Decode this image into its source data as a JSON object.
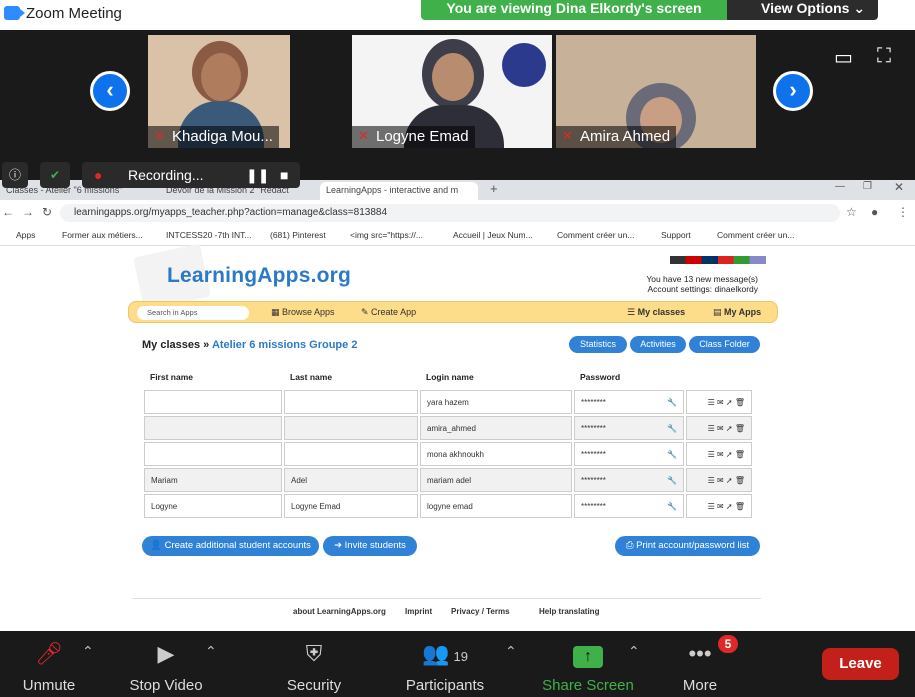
{
  "zoom": {
    "title": "Zoom Meeting",
    "viewing_banner": "You are viewing Dina Elkordy's screen",
    "view_options": "View Options"
  },
  "participants": [
    {
      "name": "Khadiga Mou...",
      "bg": "#d9c2a8"
    },
    {
      "name": "Logyne Emad",
      "bg": "#f4f4f4"
    },
    {
      "name": "Amira Ahmed",
      "bg": "#c7b299"
    }
  ],
  "recording": {
    "label": "Recording..."
  },
  "tabs": [
    "Classes - Atelier \"6 missions\"",
    "Devoir de la Mission 2 \"Rédact",
    "LearningApps - interactive and m"
  ],
  "address": {
    "url": "learningapps.org/myapps_teacher.php?action=manage&class=813884"
  },
  "bookmarks": [
    "Apps",
    "Former aux métiers...",
    "INTCESS20 -7th INT...",
    "(681) Pinterest",
    "<img src=\"https://...",
    "Accueil | Jeux Num...",
    "Comment créer un...",
    "Support",
    "Comment créer un..."
  ],
  "site": {
    "logo": "LearningApps.org",
    "messages": "You have 13 new message(s)",
    "account": "Account settings: dinaelkordy",
    "search_placeholder": "Search in Apps",
    "browse": "Browse Apps",
    "create": "Create App",
    "my_classes": "My classes",
    "my_apps": "My Apps"
  },
  "crumb": {
    "root": "My classes",
    "sep": "»",
    "class_name": "Atelier 6 missions Groupe 2"
  },
  "actions": {
    "statistics": "Statistics",
    "activities": "Activities",
    "folder": "Class Folder"
  },
  "table": {
    "headers": [
      "First name",
      "Last name",
      "Login name",
      "Password"
    ],
    "rows": [
      {
        "first": "",
        "last": "",
        "login": "yara hazem",
        "pw": "********"
      },
      {
        "first": "",
        "last": "",
        "login": "amira_ahmed",
        "pw": "********"
      },
      {
        "first": "",
        "last": "",
        "login": "mona akhnoukh",
        "pw": "********"
      },
      {
        "first": "Mariam",
        "last": "Adel",
        "login": "mariam adel",
        "pw": "********"
      },
      {
        "first": "Logyne",
        "last": "Logyne Emad",
        "login": "logyne emad",
        "pw": "********"
      }
    ]
  },
  "buttons": {
    "create_accounts": "Create additional student accounts",
    "invite": "Invite students",
    "print": "Print account/password list"
  },
  "footer": {
    "about": "about LearningApps.org",
    "imprint": "Imprint",
    "privacy": "Privacy / Terms",
    "translate": "Help translating"
  },
  "toolbar": {
    "unmute": "Unmute",
    "stop_video": "Stop Video",
    "security": "Security",
    "participants": "Participants",
    "participant_count": "19",
    "share": "Share Screen",
    "more": "More",
    "more_badge": "5",
    "leave": "Leave"
  },
  "colors": {
    "share_green": "#3fb04a",
    "zoom_blue": "#0e72ed",
    "leave_red": "#c3201b"
  }
}
